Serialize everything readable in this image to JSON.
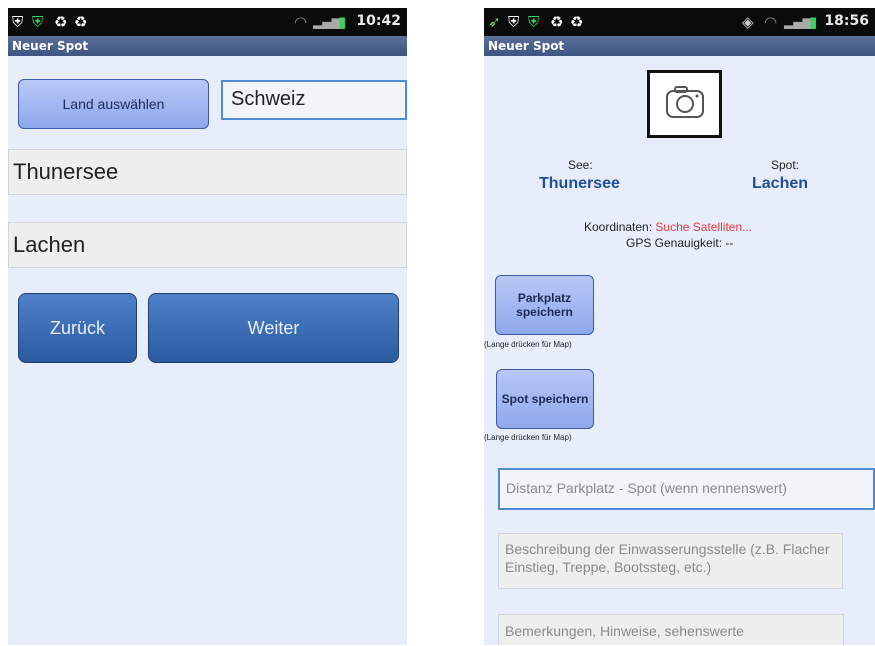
{
  "screen1": {
    "status": {
      "time": "10:42"
    },
    "title": "Neuer Spot",
    "land_button": "Land auswählen",
    "land_value": "Schweiz",
    "see_value": "Thunersee",
    "spot_value": "Lachen",
    "back_button": "Zurück",
    "next_button": "Weiter"
  },
  "screen2": {
    "status": {
      "time": "18:56"
    },
    "title": "Neuer Spot",
    "see_label": "See:",
    "see_value": "Thunersee",
    "spot_label": "Spot:",
    "spot_value": "Lachen",
    "coords_label": "Koordinaten:",
    "coords_value": "Suche Satelliten...",
    "gps_accuracy": "GPS Genauigkeit: --",
    "parking_button": "Parkplatz speichern",
    "parking_hint": "(Lange drücken für Map)",
    "spot_button": "Spot speichern",
    "spot_hint": "(Lange drücken für Map)",
    "distance_placeholder": "Distanz Parkplatz - Spot (wenn nennenswert)",
    "entry_placeholder": "Beschreibung der Einwasserungsstelle (z.B. Flacher Einstieg, Treppe, Bootssteg, etc.)",
    "notes_placeholder": "Bemerkungen, Hinweise, sehenswerte"
  },
  "colors": {
    "accent": "#3e5582",
    "button_dark": "#2a5aa0",
    "button_light": "#8ea8ec",
    "coords_red": "#e23a3a",
    "value_blue": "#1f4f9a"
  },
  "icons": [
    "shield-icon",
    "shield-check-icon",
    "recycle-icon",
    "wifi-icon",
    "signal-icon",
    "battery-icon",
    "location-icon",
    "camera-icon"
  ]
}
